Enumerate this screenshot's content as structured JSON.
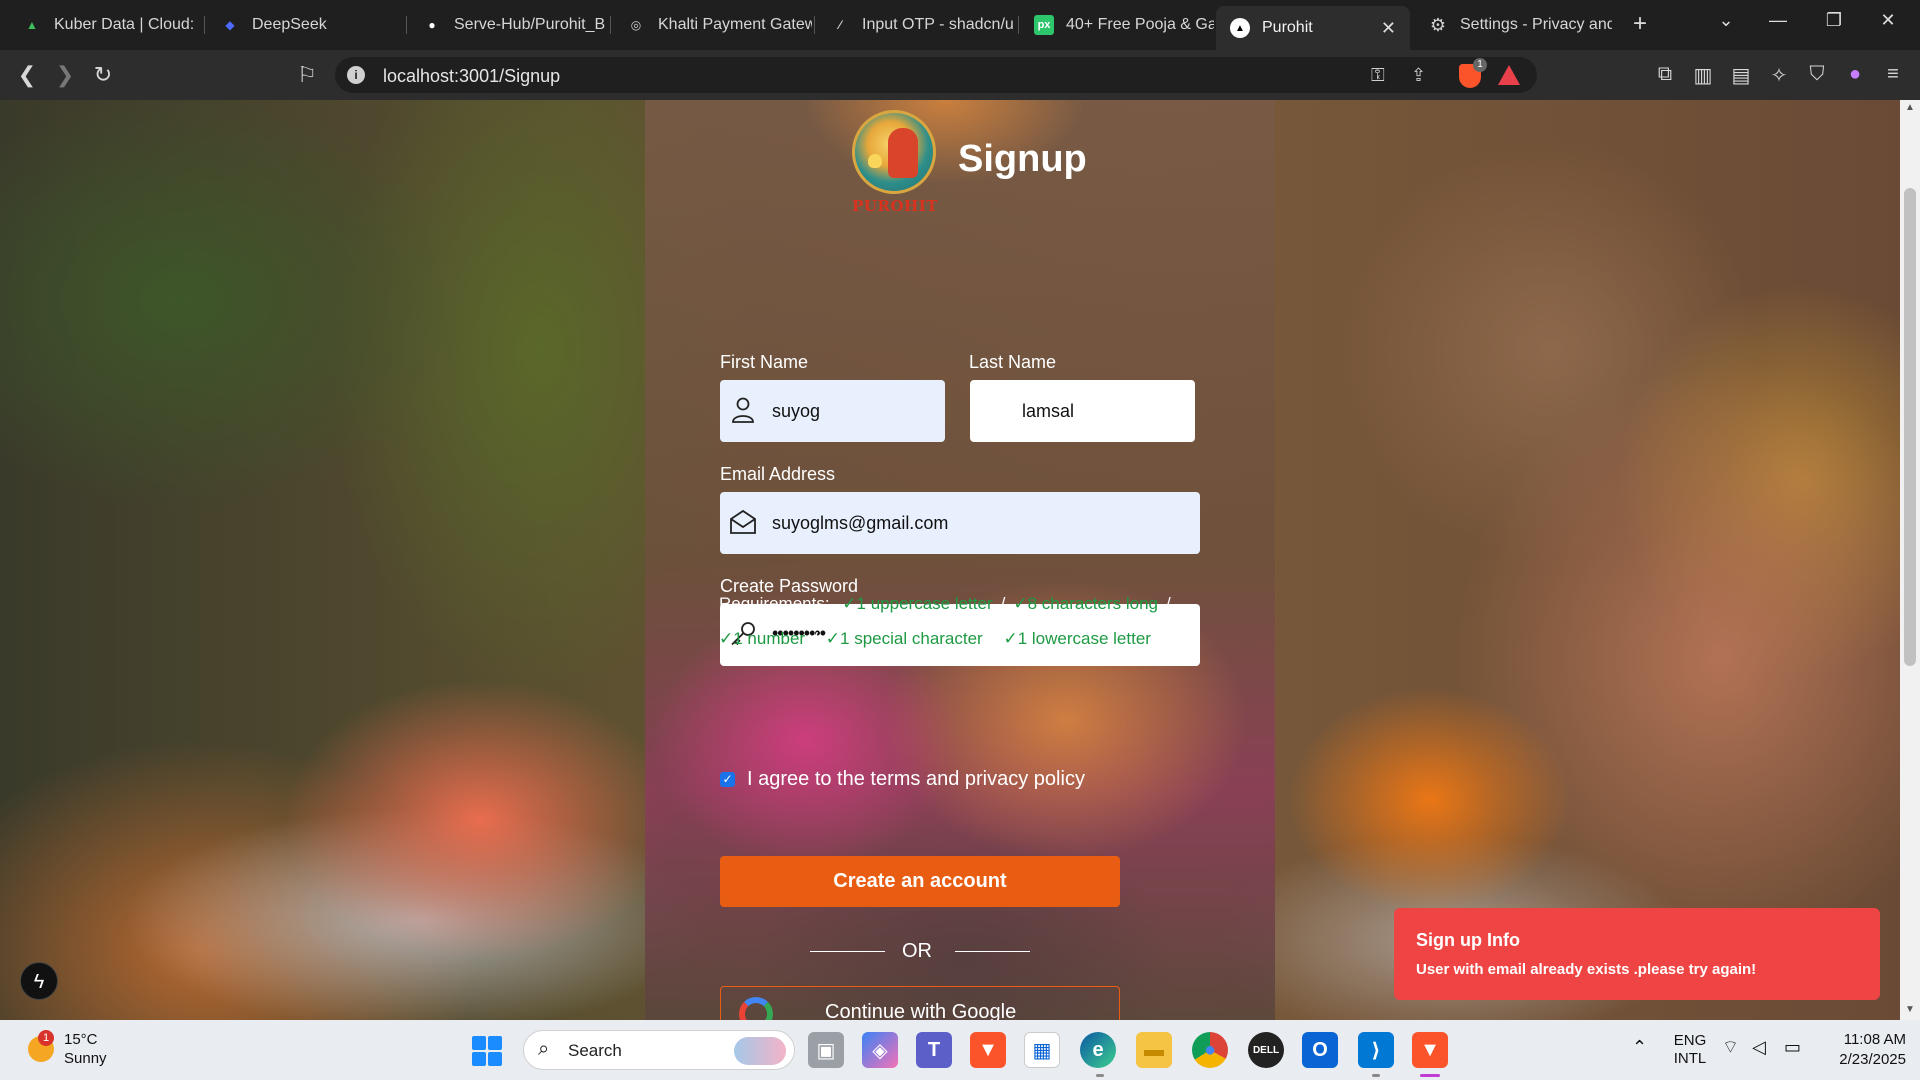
{
  "browser": {
    "tabs": [
      {
        "title": "Kuber Data | Cloud: M",
        "icon": "kuber-leaf-icon",
        "color": "#3fbf5a"
      },
      {
        "title": "DeepSeek",
        "icon": "deepseek-whale-icon",
        "color": "#4d6bfe"
      },
      {
        "title": "Serve-Hub/Purohit_B",
        "icon": "github-icon",
        "color": "#ffffff"
      },
      {
        "title": "Khalti Payment Gatew",
        "icon": "khalti-icon",
        "color": "#d0d0d0"
      },
      {
        "title": "Input OTP - shadcn/u",
        "icon": "shadcn-icon",
        "color": "#cfcfcf"
      },
      {
        "title": "40+ Free Pooja & Ga",
        "icon": "pixabay-icon",
        "color": "#2ec66d"
      },
      {
        "title": "Purohit",
        "icon": "vercel-triangle-icon",
        "color": "#ffffff"
      },
      {
        "title": "Settings - Privacy and",
        "icon": "gear-icon",
        "color": "#d0d0d0"
      }
    ],
    "tab_fav_glyphs": [
      "▲",
      "◆",
      "●",
      "◎",
      "⁄",
      "px",
      "▲",
      "⚙"
    ],
    "close_glyph": "✕",
    "new_tab_glyph": "+",
    "url": "localhost:3001/Signup",
    "shield_count": "1"
  },
  "page": {
    "logo_text": "PUROHIT",
    "title": "Signup",
    "first_name": {
      "label": "First Name",
      "value": "suyog"
    },
    "last_name": {
      "label": "Last Name",
      "value": "lamsal"
    },
    "email": {
      "label": "Email Address",
      "value": "suyoglms@gmail.com"
    },
    "password": {
      "label": "Create Password",
      "value": "••••••••••"
    },
    "requirements": {
      "heading": "Requirements:",
      "items": [
        "✓1 uppercase letter",
        "✓8 characters long",
        "✓1 number",
        "✓1 special character",
        "✓1 lowercase letter"
      ],
      "separator": "/"
    },
    "agree": {
      "checked": true,
      "text": "I agree to the terms and privacy policy"
    },
    "submit_label": "Create an account",
    "or_text": "OR",
    "google_label": "Continue with Google"
  },
  "toast": {
    "title": "Sign up Info",
    "message": "User with email already exists .please try again!",
    "color": "#ef4444"
  },
  "taskbar": {
    "weather": {
      "badge": "1",
      "temp": "15°C",
      "condition": "Sunny"
    },
    "search_label": "Search",
    "language": {
      "line1": "ENG",
      "line2": "INTL"
    },
    "time": "11:08 AM",
    "date": "2/23/2025"
  },
  "colors": {
    "accent": "#e85d12",
    "requirement_ok": "#1e9a43",
    "toast": "#ef4444"
  }
}
